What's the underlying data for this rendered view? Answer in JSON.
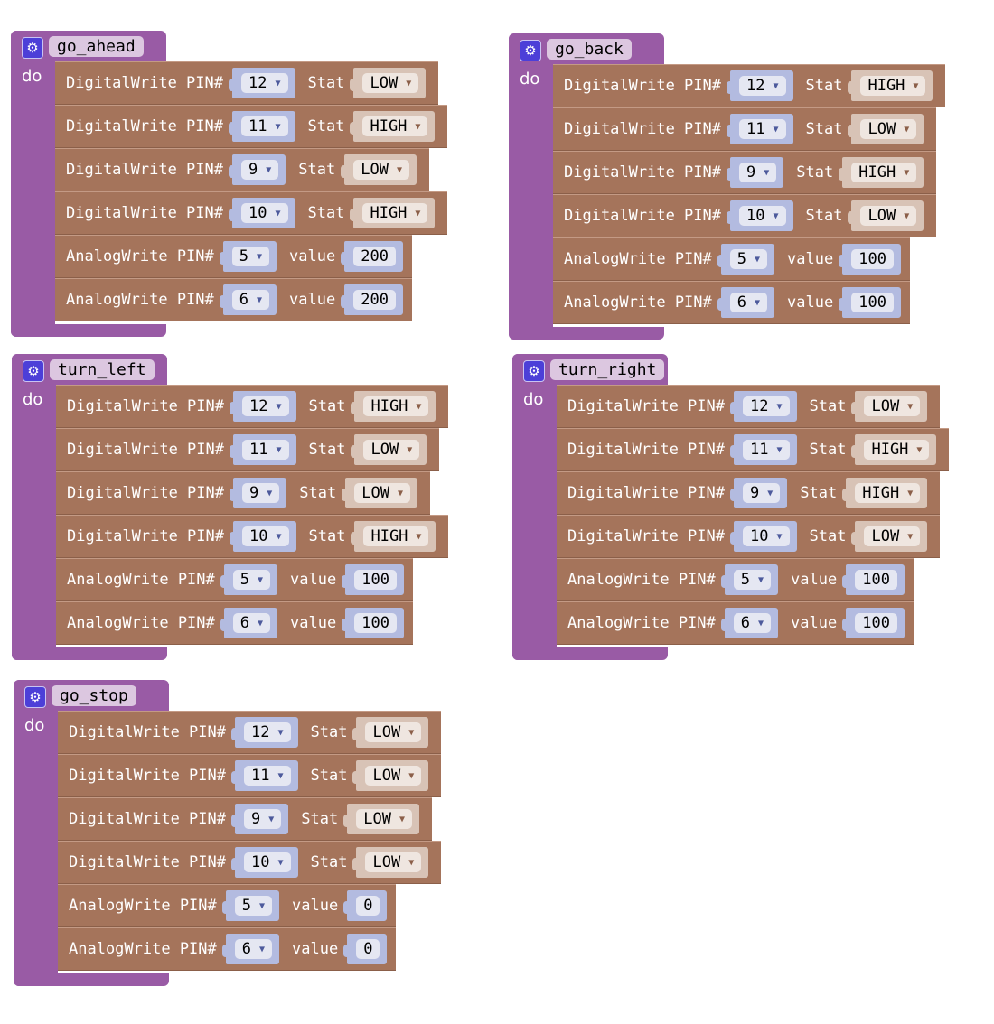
{
  "colors": {
    "procedure": "#995ba5",
    "io_block": "#a5745b",
    "pin_socket": "#b3bbe0",
    "stat_socket": "#d8c3b6",
    "gear": "#4c3fd8"
  },
  "do_label": "do",
  "stat_label": "Stat",
  "value_label": "value",
  "digital_label": "DigitalWrite PIN#",
  "analog_label": "AnalogWrite PIN#",
  "procedures": [
    {
      "name": "go_ahead",
      "rows": [
        {
          "type": "digital",
          "pin": "12",
          "stat": "LOW"
        },
        {
          "type": "digital",
          "pin": "11",
          "stat": "HIGH"
        },
        {
          "type": "digital",
          "pin": "9",
          "stat": "LOW"
        },
        {
          "type": "digital",
          "pin": "10",
          "stat": "HIGH"
        },
        {
          "type": "analog",
          "pin": "5",
          "value": "200"
        },
        {
          "type": "analog",
          "pin": "6",
          "value": "200"
        }
      ]
    },
    {
      "name": "go_back",
      "rows": [
        {
          "type": "digital",
          "pin": "12",
          "stat": "HIGH"
        },
        {
          "type": "digital",
          "pin": "11",
          "stat": "LOW"
        },
        {
          "type": "digital",
          "pin": "9",
          "stat": "HIGH"
        },
        {
          "type": "digital",
          "pin": "10",
          "stat": "LOW"
        },
        {
          "type": "analog",
          "pin": "5",
          "value": "100"
        },
        {
          "type": "analog",
          "pin": "6",
          "value": "100"
        }
      ]
    },
    {
      "name": "turn_left",
      "rows": [
        {
          "type": "digital",
          "pin": "12",
          "stat": "HIGH"
        },
        {
          "type": "digital",
          "pin": "11",
          "stat": "LOW"
        },
        {
          "type": "digital",
          "pin": "9",
          "stat": "LOW"
        },
        {
          "type": "digital",
          "pin": "10",
          "stat": "HIGH"
        },
        {
          "type": "analog",
          "pin": "5",
          "value": "100"
        },
        {
          "type": "analog",
          "pin": "6",
          "value": "100"
        }
      ]
    },
    {
      "name": "turn_right",
      "rows": [
        {
          "type": "digital",
          "pin": "12",
          "stat": "LOW"
        },
        {
          "type": "digital",
          "pin": "11",
          "stat": "HIGH"
        },
        {
          "type": "digital",
          "pin": "9",
          "stat": "HIGH"
        },
        {
          "type": "digital",
          "pin": "10",
          "stat": "LOW"
        },
        {
          "type": "analog",
          "pin": "5",
          "value": "100"
        },
        {
          "type": "analog",
          "pin": "6",
          "value": "100"
        }
      ]
    },
    {
      "name": "go_stop",
      "rows": [
        {
          "type": "digital",
          "pin": "12",
          "stat": "LOW"
        },
        {
          "type": "digital",
          "pin": "11",
          "stat": "LOW"
        },
        {
          "type": "digital",
          "pin": "9",
          "stat": "LOW"
        },
        {
          "type": "digital",
          "pin": "10",
          "stat": "LOW"
        },
        {
          "type": "analog",
          "pin": "5",
          "value": "0"
        },
        {
          "type": "analog",
          "pin": "6",
          "value": "0"
        }
      ]
    }
  ]
}
